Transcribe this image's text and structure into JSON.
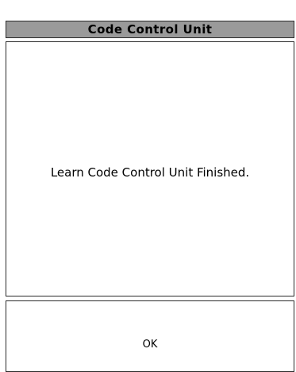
{
  "dialog": {
    "title": "Code Control Unit",
    "message": "Learn Code Control Unit Finished.",
    "ok_label": "OK"
  },
  "colors": {
    "title_bar_bg": "#9a9a9a",
    "border": "#2a2a2a",
    "background": "#ffffff",
    "text": "#000000"
  }
}
